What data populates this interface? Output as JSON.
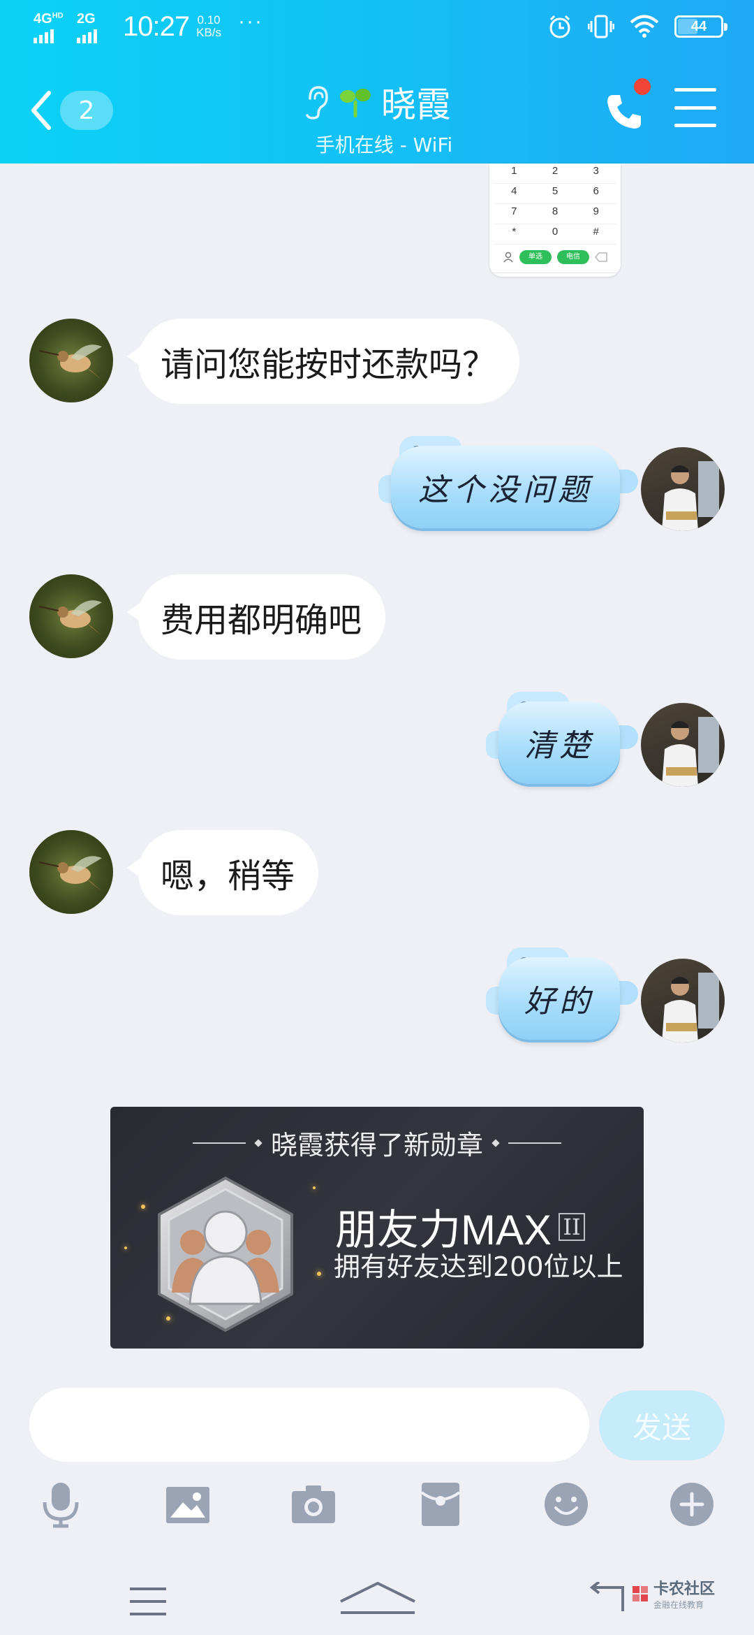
{
  "status_bar": {
    "network1": "4G",
    "network1_sup": "HD",
    "network2": "2G",
    "time": "10:27",
    "speed_value": "0.10",
    "speed_unit": "KB/s",
    "more": "···",
    "battery": "44"
  },
  "header": {
    "unread_count": "2",
    "contact_name": "晓霞",
    "contact_status": "手机在线 - WiFi"
  },
  "shared_image": {
    "keys": [
      "1",
      "2",
      "3",
      "4",
      "5",
      "6",
      "7",
      "8",
      "9",
      "*",
      "0",
      "#"
    ],
    "btn_a": "单选",
    "btn_b": "电信"
  },
  "messages": [
    {
      "side": "left",
      "text": "请问您能按时还款吗？"
    },
    {
      "side": "right",
      "text": "这个没问题"
    },
    {
      "side": "left",
      "text": "费用都明确吧"
    },
    {
      "side": "right",
      "text": "清楚"
    },
    {
      "side": "left",
      "text": "嗯，稍等"
    },
    {
      "side": "right",
      "text": "好的"
    }
  ],
  "badge_card": {
    "title": "晓霞获得了新勋章",
    "name": "朋友力MAX",
    "level": "II",
    "description": "拥有好友达到200位以上"
  },
  "composer": {
    "placeholder": "",
    "send_label": "发送"
  },
  "toolbar": {
    "icons": [
      "microphone-icon",
      "image-icon",
      "camera-icon",
      "red-packet-icon",
      "emoji-icon",
      "plus-icon"
    ]
  },
  "watermark": {
    "title": "卡农社区",
    "subtitle": "金融在线教育"
  },
  "colors": {
    "header_start": "#0bd2f5",
    "header_end": "#20a9f6",
    "chat_bg": "#eef0f6",
    "notification_dot": "#f24437",
    "send_button": "#c6ecfb"
  }
}
